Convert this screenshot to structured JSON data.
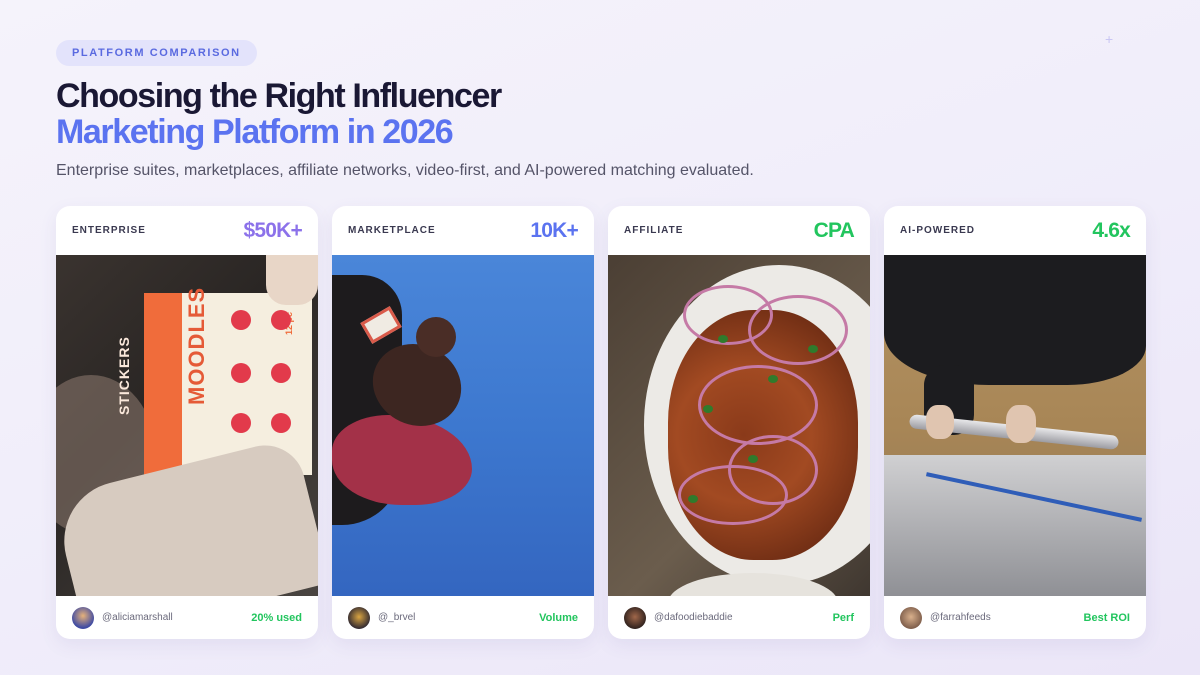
{
  "header": {
    "badge": "PLATFORM COMPARISON",
    "title_line1": "Choosing the Right Influencer",
    "title_line2": "Marketing Platform in 2026",
    "subtitle": "Enterprise suites, marketplaces, affiliate networks, video-first, and AI-powered matching evaluated."
  },
  "colors": {
    "accent": "#5b73f0",
    "positive": "#22c55e"
  },
  "cards": [
    {
      "label": "ENTERPRISE",
      "metric": "$50K+",
      "metric_color": "#8c72ea",
      "handle": "@aliciamarshall",
      "tag": "20% used"
    },
    {
      "label": "MARKETPLACE",
      "metric": "10K+",
      "metric_color": "#5b73f0",
      "handle": "@_brvel",
      "tag": "Volume"
    },
    {
      "label": "AFFILIATE",
      "metric": "CPA",
      "metric_color": "#22c55e",
      "handle": "@dafoodiebaddie",
      "tag": "Perf"
    },
    {
      "label": "AI-POWERED",
      "metric": "4.6x",
      "metric_color": "#22c55e",
      "handle": "@farrahfeeds",
      "tag": "Best ROI"
    }
  ],
  "stickers_pack": {
    "text_a": "STICKERS",
    "text_b": "MOODLES",
    "text_c": "12 pc"
  },
  "icons": [
    "sparkle-icon",
    "avatar-icon"
  ]
}
